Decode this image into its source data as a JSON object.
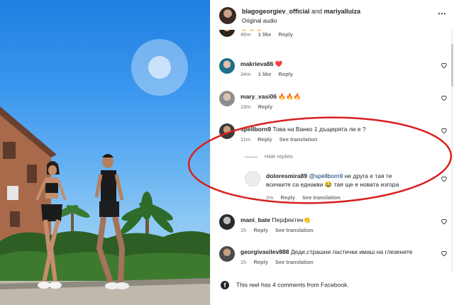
{
  "header": {
    "user1": "blagogeorgiev_official",
    "and_text": "and",
    "user2": "mariyalluiza",
    "audio": "Original audio",
    "more_icon": "more-horizontal-icon"
  },
  "partial_comment": {
    "text": "",
    "time": "46m",
    "likes": "1 like",
    "reply": "Reply"
  },
  "comments": [
    {
      "user": "makrieva86",
      "text": "❤️",
      "time": "34m",
      "likes": "1 like",
      "reply": "Reply"
    },
    {
      "user": "mary_vasi06",
      "text": "🔥🔥🔥",
      "time": "19m",
      "reply": "Reply"
    },
    {
      "user": "spellborn9",
      "text": "Това на Ванко 1 дъщерята ли е ?",
      "time": "11m",
      "reply": "Reply",
      "translate": "See translation"
    }
  ],
  "hide_replies": "Hide replies",
  "reply_comment": {
    "user": "doloresmira89",
    "mention": "@spellborn9",
    "text": " не друга е тая те всичките са еднакви 😂 тая ще е новата изгора",
    "text_line1": " не друга е тая те",
    "text_line2": "всичките са еднакви 😂 тая ще е новата изгора",
    "time": "2m",
    "reply": "Reply",
    "translate": "See translation"
  },
  "comments_after": [
    {
      "user": "mani_bate",
      "text": "Перфектен👏",
      "time": "1h",
      "reply": "Reply",
      "translate": "See translation"
    },
    {
      "user": "georgivasilev888",
      "text": "Деди,страшни ластички имаш на глезените",
      "time": "1h",
      "reply": "Reply",
      "translate": "See translation"
    }
  ],
  "facebook_note": "This reel has 4 comments from Facebook.",
  "colors": {
    "annotation": "#d9201f",
    "mention": "#00376b",
    "secondary": "#737373"
  }
}
